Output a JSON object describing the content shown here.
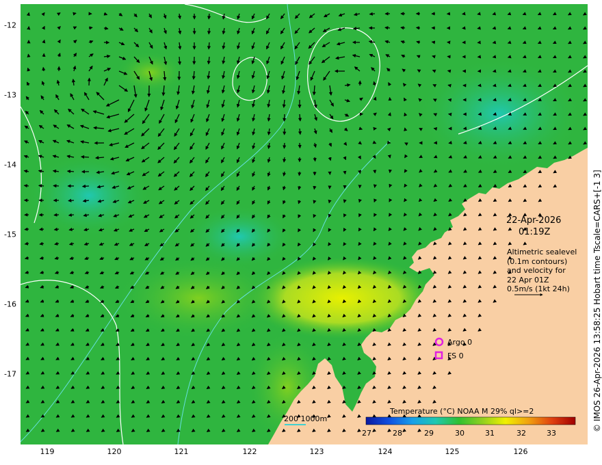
{
  "map": {
    "x_ticks": [
      "119",
      "120",
      "121",
      "122",
      "123",
      "124",
      "125",
      "126"
    ],
    "y_ticks": [
      "-12",
      "-13",
      "-14",
      "-15",
      "-16",
      "-17"
    ],
    "lon_range": [
      118.6,
      127.0
    ],
    "lat_range": [
      -12.0,
      -18.0
    ],
    "colors": {
      "land": "#f9cfa4",
      "sea_base": "#2fb53f",
      "contour": "#ffffff",
      "isobath": "#66e0e0",
      "marker": "#e020e0"
    }
  },
  "annotations": {
    "date": "22-Apr-2026",
    "time": "01:19Z",
    "alti_lines": [
      "Altimetric sealevel",
      "(0.1m contours)",
      "and velocity for",
      "22 Apr 01Z",
      "0.5m/s (1kt 24h)"
    ],
    "argo": "Argo 0",
    "fs": "FS 0",
    "scale": "200  1000m"
  },
  "colorbar": {
    "title": "Temperature (°C) NOAA  M 29% ql>=2",
    "ticks": [
      "27",
      "28",
      "29",
      "30",
      "31",
      "32",
      "33"
    ],
    "range": [
      27,
      33.8
    ],
    "stops": [
      "#0b1aa0",
      "#1050e0",
      "#18a0e8",
      "#20c8b0",
      "#30c030",
      "#90d020",
      "#f0f000",
      "#f0a010",
      "#e04010",
      "#a00000"
    ]
  },
  "credit": "© IMOS 26-Apr-2026 13:58:25 Hobart time Tscale=CARS+[-1 3]"
}
